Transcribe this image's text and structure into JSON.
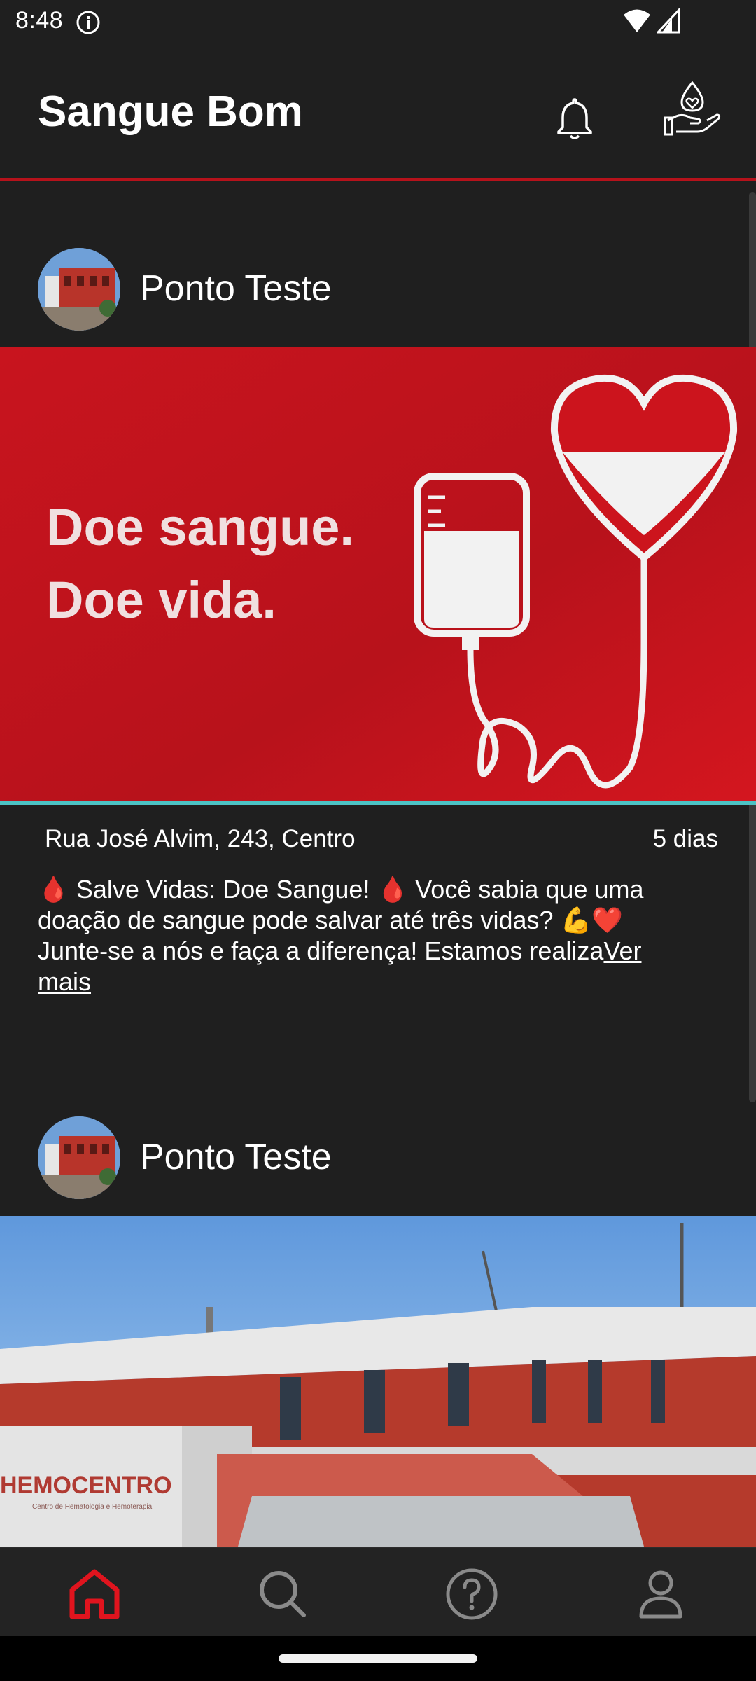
{
  "status_bar": {
    "time": "8:48",
    "icons": [
      "info-icon",
      "wifi-icon",
      "signal-icon"
    ]
  },
  "app_bar": {
    "title": "Sangue Bom",
    "actions": [
      "bell-icon",
      "blood-donation-icon"
    ]
  },
  "colors": {
    "accent": "#b5121b",
    "background": "#1f1f1f",
    "active_nav": "#e0141e",
    "inactive_nav": "#8a8a8a",
    "divider_teal": "#4cc2c4"
  },
  "posts": [
    {
      "author": "Ponto Teste",
      "image_text_line1": "Doe sangue.",
      "image_text_line2": "Doe vida.",
      "address": "Rua José Alvim, 243, Centro",
      "time_ago": "5 dias",
      "text": "🩸 Salve Vidas: Doe Sangue! 🩸 Você sabia que uma doação de sangue pode salvar até três vidas? 💪❤️ Junte-se a nós e faça a diferença! Estamos realiza",
      "see_more": "Ver mais"
    },
    {
      "author": "Ponto Teste",
      "image_sign": "HEMOCENTRO",
      "image_sign_sub": "Centro de Hematologia e Hemoterapia"
    }
  ],
  "bottom_nav": {
    "items": [
      "home-icon",
      "search-icon",
      "help-icon",
      "profile-icon"
    ],
    "active": "home-icon"
  }
}
